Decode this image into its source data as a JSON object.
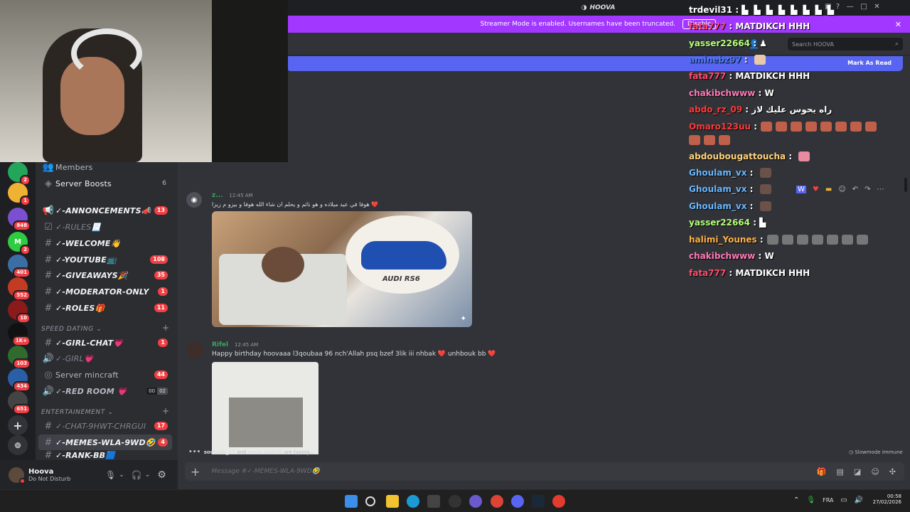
{
  "app": {
    "title": "HOOVA"
  },
  "streamer_banner": {
    "text": "Streamer Mode is enabled. Usernames have been truncated.",
    "disable_label": "Disable"
  },
  "header": {
    "search_placeholder": "Search HOOVA",
    "mark_as_read": "Mark As Read"
  },
  "rail": {
    "badges": [
      "2",
      "1",
      "848",
      "2",
      "401",
      "552",
      "10",
      "1K+",
      "103",
      "434",
      "651"
    ]
  },
  "sidebar": {
    "members": "Members",
    "server_boosts": "Server Boosts",
    "server_boosts_count": "6",
    "channels": [
      {
        "name": "✓-ANNONCEMENTS📣",
        "count": "13"
      },
      {
        "name": "✓-RULES📃",
        "count": ""
      },
      {
        "name": "✓-WELCOME👋",
        "count": ""
      },
      {
        "name": "✓-YOUTUBE📺",
        "count": "108"
      },
      {
        "name": "✓-GIVEAWAYS🎉",
        "count": "35"
      },
      {
        "name": "✓-MODERATOR-ONLY",
        "count": "1"
      },
      {
        "name": "✓-ROLES🎁",
        "count": "11"
      }
    ],
    "category_speed_dating": "SPEED DATING",
    "speed_dating": [
      {
        "name": "✓-GIRL-CHAT💗",
        "count": "1"
      },
      {
        "name": "✓-GIRL💗",
        "count": ""
      },
      {
        "name": "Server mincraft",
        "count": "44"
      },
      {
        "name": "✓-RED ROOM 💗",
        "count": ""
      }
    ],
    "red_room_users": "00",
    "red_room_limit": "02",
    "category_entertainment": "ENTERTAINEMENT",
    "entertainment": [
      {
        "name": "✓-CHAT-9HWT-CHRGUI",
        "count": "17"
      },
      {
        "name": "✓-MEMES-WLA-9WD🤣",
        "count": "4"
      },
      {
        "name": "✓-RANK-BB🟦",
        "count": ""
      }
    ]
  },
  "user": {
    "name": "Hoova",
    "status": "Do Not Disturb"
  },
  "messages": [
    {
      "author": "z...",
      "time": "12:45 AM",
      "text": "هوفا في عيد ميلاده و هو نائم و يحلم ان شاء الله هوفا و بيزو م زيزا ❤️",
      "image_caption": "AUDI RS6"
    },
    {
      "author": "Rifel",
      "time": "12:45 AM",
      "text": "Happy birthday hoovaaa l3qoubaa 96 nch'Allah psq bzef 3lik iii nhbak ❤️ unhbouk bb ❤️"
    }
  ],
  "typing": {
    "user1": "souhaib_17",
    "and": "and",
    "user2": "imad abdelli",
    "suffix": "are typing..."
  },
  "slowmode": "Slowmode Immune",
  "composer": {
    "placeholder": "Message #✓-MEMES-WLA-9WD🤣"
  },
  "chat_overlay": [
    {
      "user": "trdevil31",
      "color": "#ffffff",
      "text": ""
    },
    {
      "user": "fata777",
      "color": "#ff4d6d",
      "text": "MATDIKCH HHH"
    },
    {
      "user": "yasser22664",
      "color": "#b6ff7a",
      "text": ""
    },
    {
      "user": "aminebz97",
      "color": "#4d7dff",
      "text": ""
    },
    {
      "user": "fata777",
      "color": "#ff4d6d",
      "text": "MATDIKCH HHH"
    },
    {
      "user": "chakibchwww",
      "color": "#ff7ab6",
      "text": ""
    },
    {
      "user": "abdo_rz_09",
      "color": "#ff3b3b",
      "text": "راه يحوس عليك لاز"
    },
    {
      "user": "Omaro123uu",
      "color": "#ff3b3b",
      "text": ""
    },
    {
      "user": "abdoubougattoucha",
      "color": "#ffd27a",
      "text": ""
    },
    {
      "user": "Ghoulam_vx",
      "color": "#6ab7ff",
      "text": ""
    },
    {
      "user": "Ghoulam_vx",
      "color": "#6ab7ff",
      "text": ""
    },
    {
      "user": "Ghoulam_vx",
      "color": "#6ab7ff",
      "text": ""
    },
    {
      "user": "yasser22664",
      "color": "#b6ff7a",
      "text": ""
    },
    {
      "user": "halimi_Younes",
      "color": "#ffb347",
      "text": ""
    },
    {
      "user": "chakibchwww",
      "color": "#ff7ab6",
      "text": ""
    },
    {
      "user": "fata777",
      "color": "#ff4d6d",
      "text": "MATDIKCH HHH"
    }
  ],
  "taskbar": {
    "lang": "FRA",
    "time": "00:58",
    "date": "27/02/2026"
  },
  "colors": {
    "accent": "#5865f2",
    "streamer": "#a238ff",
    "badge": "#f23f43"
  }
}
